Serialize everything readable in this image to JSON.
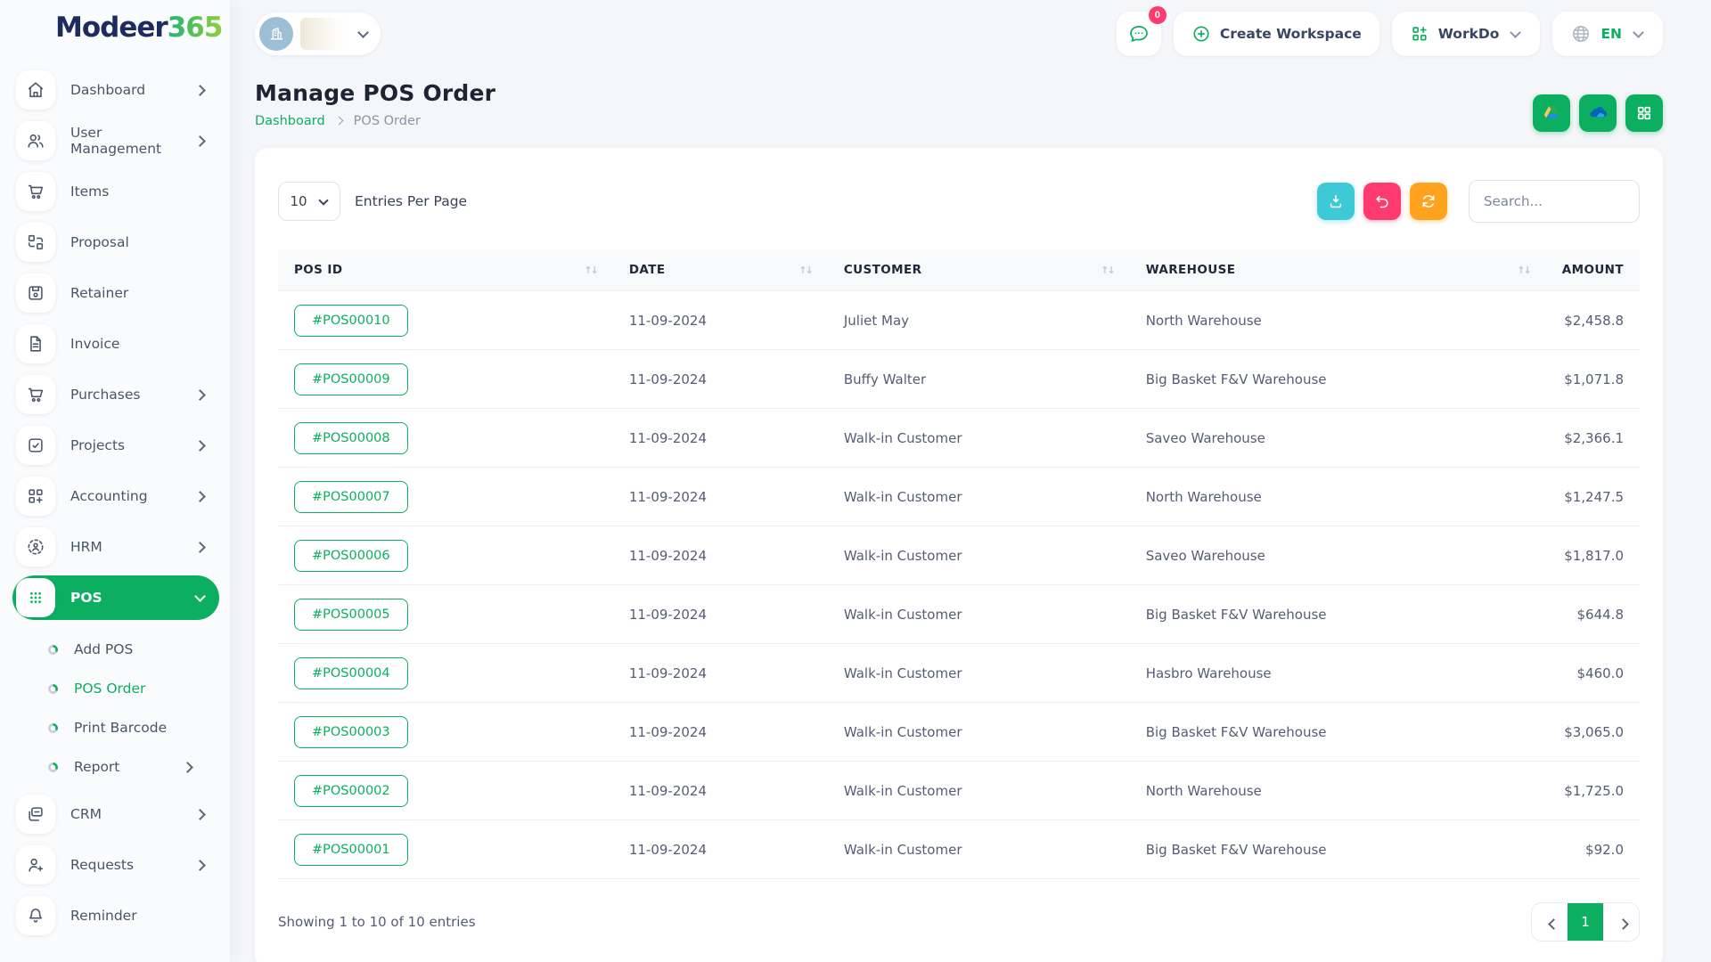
{
  "brand": {
    "name_primary": "Modeer",
    "name_secondary": "365"
  },
  "header": {
    "notification_badge": "0",
    "create_workspace_label": "Create Workspace",
    "workdo_label": "WorkDo",
    "language": "EN",
    "icons": [
      "chat-icon",
      "plus-circle-icon",
      "apps-grid-icon",
      "globe-icon",
      "building-icon"
    ]
  },
  "page": {
    "title": "Manage POS Order",
    "breadcrumb_home": "Dashboard",
    "breadcrumb_current": "POS Order",
    "action_icons": [
      "google-drive-icon",
      "onedrive-icon",
      "grid-icon"
    ]
  },
  "sidebar": {
    "items": [
      {
        "label": "Dashboard",
        "icon": "home-icon",
        "chevron": true
      },
      {
        "label": "User Management",
        "icon": "users-icon",
        "chevron": true
      },
      {
        "label": "Items",
        "icon": "cart-icon",
        "chevron": false
      },
      {
        "label": "Proposal",
        "icon": "proposal-icon",
        "chevron": false
      },
      {
        "label": "Retainer",
        "icon": "retainer-icon",
        "chevron": false
      },
      {
        "label": "Invoice",
        "icon": "invoice-icon",
        "chevron": false
      },
      {
        "label": "Purchases",
        "icon": "cart-icon",
        "chevron": true
      },
      {
        "label": "Projects",
        "icon": "projects-icon",
        "chevron": true
      },
      {
        "label": "Accounting",
        "icon": "accounting-icon",
        "chevron": true
      },
      {
        "label": "HRM",
        "icon": "hrm-icon",
        "chevron": true
      },
      {
        "label": "POS",
        "icon": "pos-dots-icon",
        "chevron": true,
        "active": true
      },
      {
        "label": "CRM",
        "icon": "crm-icon",
        "chevron": true
      },
      {
        "label": "Requests",
        "icon": "user-plus-icon",
        "chevron": true
      },
      {
        "label": "Reminder",
        "icon": "bell-icon",
        "chevron": false
      }
    ],
    "pos_submenu": [
      {
        "label": "Add POS",
        "active": false
      },
      {
        "label": "POS Order",
        "active": true
      },
      {
        "label": "Print Barcode",
        "active": false
      },
      {
        "label": "Report",
        "active": false,
        "chevron": true
      }
    ]
  },
  "toolbar": {
    "entries_per_page_value": "10",
    "entries_per_page_label": "Entries Per Page",
    "search_placeholder": "Search...",
    "action_icons": [
      "download-icon",
      "undo-icon",
      "refresh-icon"
    ]
  },
  "table": {
    "columns": [
      "POS ID",
      "DATE",
      "CUSTOMER",
      "WAREHOUSE",
      "AMOUNT"
    ],
    "rows": [
      {
        "pos_id": "#POS00010",
        "date": "11-09-2024",
        "customer": "Juliet May",
        "warehouse": "North Warehouse",
        "amount": "$2,458.8"
      },
      {
        "pos_id": "#POS00009",
        "date": "11-09-2024",
        "customer": "Buffy Walter",
        "warehouse": "Big Basket F&V Warehouse",
        "amount": "$1,071.8"
      },
      {
        "pos_id": "#POS00008",
        "date": "11-09-2024",
        "customer": "Walk-in Customer",
        "warehouse": "Saveo Warehouse",
        "amount": "$2,366.1"
      },
      {
        "pos_id": "#POS00007",
        "date": "11-09-2024",
        "customer": "Walk-in Customer",
        "warehouse": "North Warehouse",
        "amount": "$1,247.5"
      },
      {
        "pos_id": "#POS00006",
        "date": "11-09-2024",
        "customer": "Walk-in Customer",
        "warehouse": "Saveo Warehouse",
        "amount": "$1,817.0"
      },
      {
        "pos_id": "#POS00005",
        "date": "11-09-2024",
        "customer": "Walk-in Customer",
        "warehouse": "Big Basket F&V Warehouse",
        "amount": "$644.8"
      },
      {
        "pos_id": "#POS00004",
        "date": "11-09-2024",
        "customer": "Walk-in Customer",
        "warehouse": "Hasbro Warehouse",
        "amount": "$460.0"
      },
      {
        "pos_id": "#POS00003",
        "date": "11-09-2024",
        "customer": "Walk-in Customer",
        "warehouse": "Big Basket F&V Warehouse",
        "amount": "$3,065.0"
      },
      {
        "pos_id": "#POS00002",
        "date": "11-09-2024",
        "customer": "Walk-in Customer",
        "warehouse": "North Warehouse",
        "amount": "$1,725.0"
      },
      {
        "pos_id": "#POS00001",
        "date": "11-09-2024",
        "customer": "Walk-in Customer",
        "warehouse": "Big Basket F&V Warehouse",
        "amount": "$92.0"
      }
    ]
  },
  "footer": {
    "showing_text": "Showing 1 to 10 of 10 entries",
    "current_page": "1"
  },
  "colors": {
    "primary_green": "#0CAF60",
    "teal": "#3EC9D6",
    "pink": "#FF3A6E",
    "orange": "#FFA21D",
    "navy_logo": "#1d2b5e",
    "page_bg": "#f5f6f9"
  }
}
